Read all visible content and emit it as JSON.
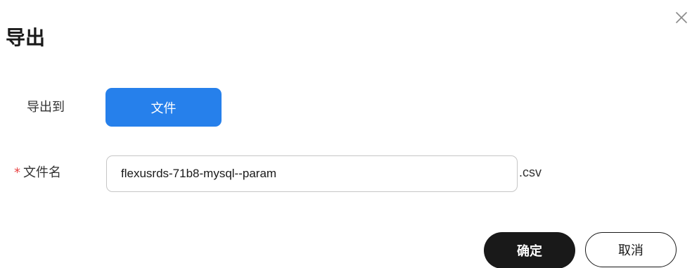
{
  "dialog": {
    "title": "导出",
    "close_icon": "close-icon"
  },
  "export_to": {
    "label": "导出到",
    "file_button_label": "文件",
    "file_button_color": "#2680eb"
  },
  "filename": {
    "required_mark": "*",
    "label": "文件名",
    "value": "flexusrds-71b8-mysql--param",
    "suffix": ".csv",
    "required_color": "#e84545"
  },
  "footer": {
    "ok_label": "确定",
    "cancel_label": "取消"
  }
}
